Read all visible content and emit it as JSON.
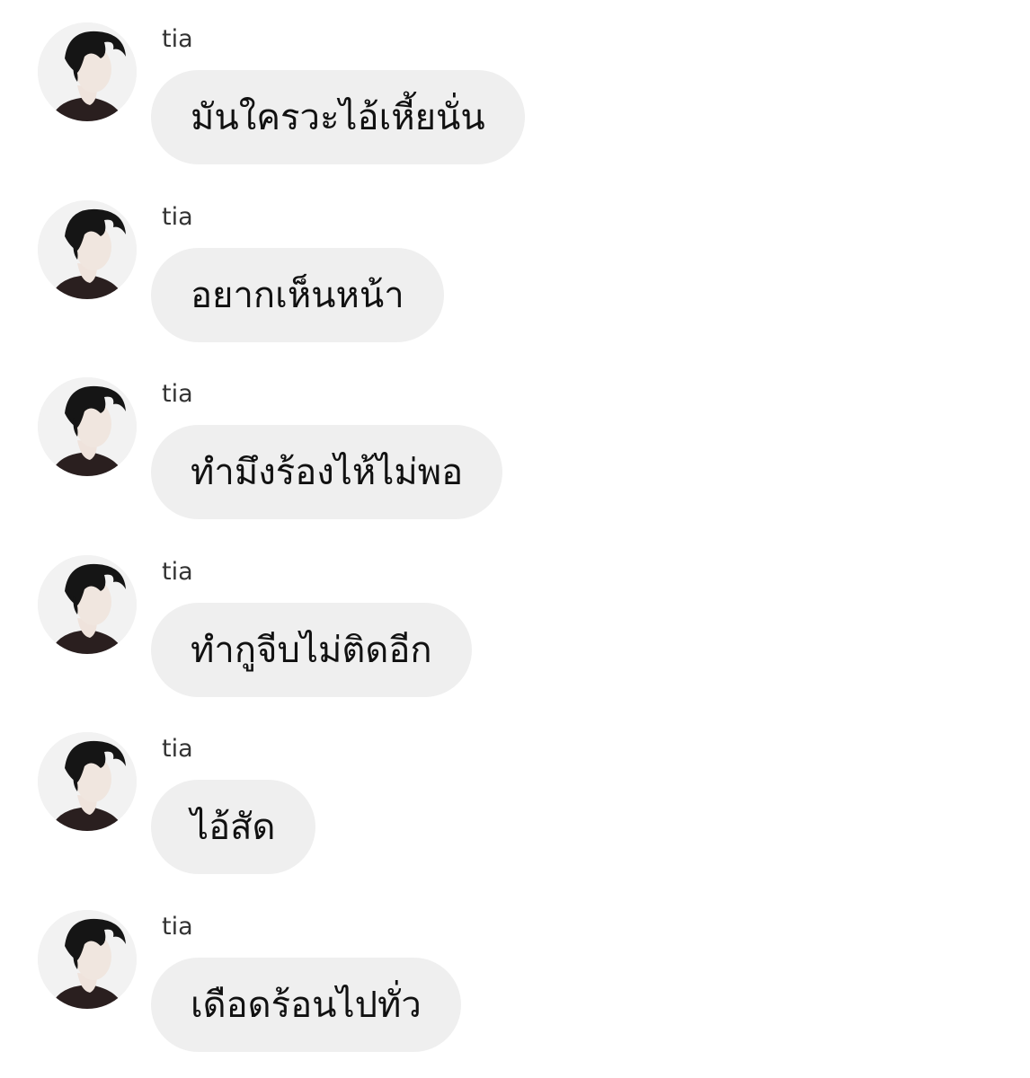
{
  "chat": {
    "bubble_color": "#efefef",
    "text_color": "#111111",
    "messages": [
      {
        "sender": "tia",
        "text": "มันใครวะไอ้เหี้ยนั่น"
      },
      {
        "sender": "tia",
        "text": "อยากเห็นหน้า"
      },
      {
        "sender": "tia",
        "text": "ทำมึงร้องไห้ไม่พอ"
      },
      {
        "sender": "tia",
        "text": "ทำกูจีบไม่ติดอีก"
      },
      {
        "sender": "tia",
        "text": "ไอ้สัด"
      },
      {
        "sender": "tia",
        "text": "เดือดร้อนไปทั่ว"
      }
    ]
  }
}
